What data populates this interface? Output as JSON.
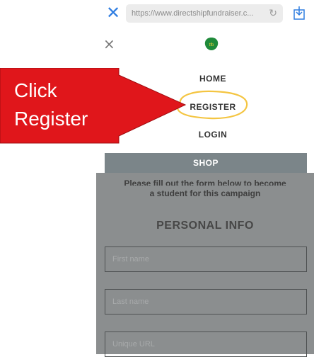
{
  "browser": {
    "url": "https://www.directshipfundraiser.c...",
    "close_icon": "close-icon",
    "reload_icon": "reload-icon",
    "share_icon": "share-icon",
    "accent_color": "#2f7de1"
  },
  "menu": {
    "close_icon": "close-icon",
    "logo_text": "tfb",
    "items": [
      {
        "label": "HOME"
      },
      {
        "label": "REGISTER"
      },
      {
        "label": "LOGIN"
      }
    ],
    "shop_label": "SHOP"
  },
  "form": {
    "intro_top": "Please fill out the form below to become",
    "intro_bottom": "a student for this campaign",
    "heading": "PERSONAL INFO",
    "fields": [
      {
        "placeholder": "First name"
      },
      {
        "placeholder": "Last name"
      },
      {
        "placeholder": "Unique URL"
      }
    ]
  },
  "annotation": {
    "line1": "Click",
    "line2": "Register",
    "arrow_color": "#e0161b",
    "highlight_color": "#f4c542"
  }
}
